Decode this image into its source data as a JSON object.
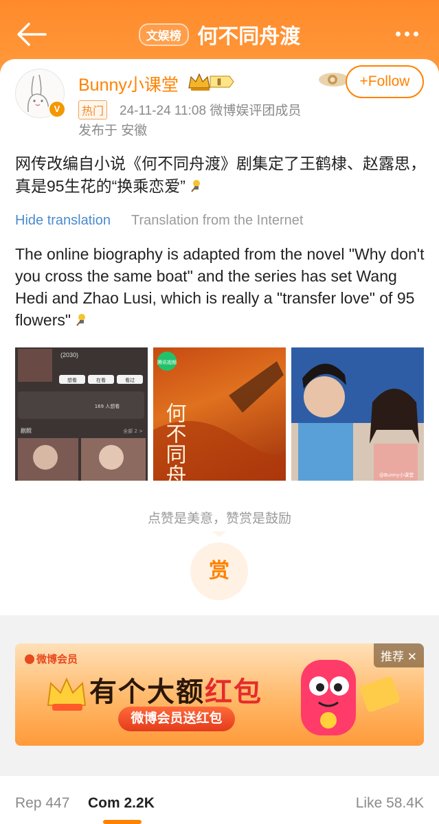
{
  "header": {
    "channel_badge": "文娱榜",
    "title": "何不同舟渡"
  },
  "author": {
    "name": "Bunny小课堂",
    "level_badge": "Ⅱ",
    "verified_mark": "V",
    "hot_tag": "热门",
    "time_and_role": "24-11-24 11:08  微博娱评团成员",
    "location": "发布于 安徽",
    "follow_label": "+Follow"
  },
  "post": {
    "text": "网传改编自小说《何不同舟渡》剧集定了王鹤棣、赵露思，真是95生花的“换乘恋爱”",
    "hide_translation_label": "Hide translation",
    "translation_source": "Translation from the Internet",
    "translated_text": "The online biography is adapted from the novel \"Why don't you cross the same boat\" and the series has set Wang Hedi and Zhao Lusi, which is really a \"transfer love\" of 95 flowers\""
  },
  "images": [
    {
      "name": "drama-info-screenshot",
      "lines": [
        "(2030)",
        "想看",
        "在看",
        "看过",
        "169 人想看",
        "剧照",
        "全部 2 >"
      ]
    },
    {
      "name": "poster",
      "watermark": "腾讯视频",
      "art_text": "何不同舟渡"
    },
    {
      "name": "actors-photo",
      "watermark": "@Bunny小课堂"
    }
  ],
  "reward": {
    "hint": "点赞是美意，赞赏是鼓励",
    "button_label": "赏"
  },
  "ad": {
    "brand": "微博会员",
    "headline_prefix": "有个大额",
    "headline_highlight": "红包",
    "pill": "微博会员送红包",
    "tag": "推荐 ✕"
  },
  "bottom_tabs": {
    "repost": "Rep 447",
    "comments": "Com 2.2K",
    "likes": "Like 58.4K"
  },
  "colors": {
    "accent": "#ff8200",
    "header_bg": "#ff8a2b",
    "link_blue": "#4a8ad0"
  }
}
